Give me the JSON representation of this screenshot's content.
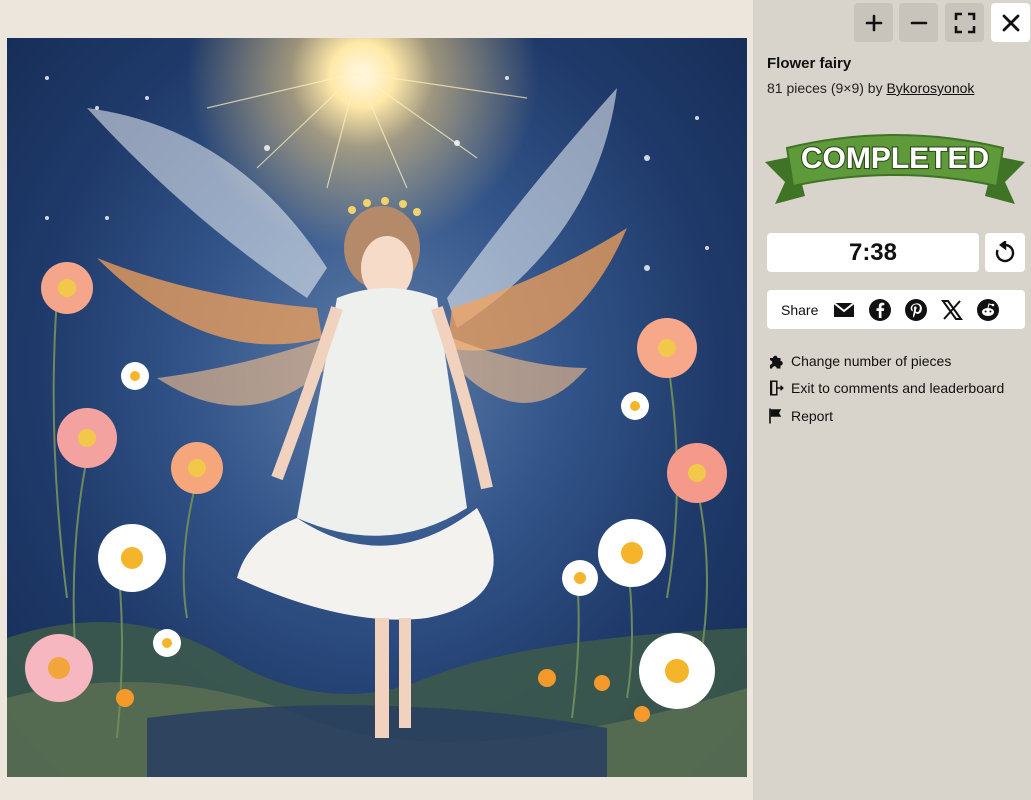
{
  "puzzle": {
    "title": "Flower fairy",
    "pieces_text": "81 pieces (9×9) by ",
    "author": "Bykorosyonok",
    "status_banner": "COMPLETED",
    "timer": "7:38"
  },
  "toolbar": {
    "zoom_in_icon": "plus-icon",
    "zoom_out_icon": "minus-icon",
    "fullscreen_icon": "fullscreen-icon",
    "close_icon": "close-icon"
  },
  "share": {
    "label": "Share",
    "icons": [
      "email-icon",
      "facebook-icon",
      "pinterest-icon",
      "x-icon",
      "reddit-icon"
    ]
  },
  "menu": {
    "change_pieces": "Change number of pieces",
    "exit_comments": "Exit to comments and leaderboard",
    "report": "Report"
  },
  "colors": {
    "sidebar_bg": "#d9d4cb",
    "board_bg": "#ece6dc",
    "banner_green": "#5e9a3a",
    "banner_dark_green": "#3f7426"
  }
}
